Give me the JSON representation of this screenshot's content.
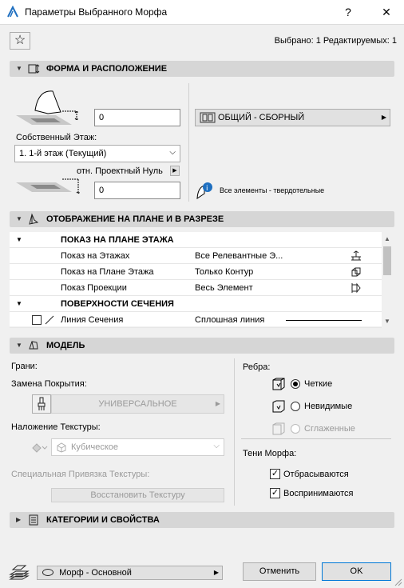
{
  "window": {
    "title": "Параметры Выбранного Морфа",
    "help_label": "?",
    "close_label": "✕"
  },
  "selection_info": "Выбрано: 1 Редактируемых: 1",
  "sections": {
    "shape": "ФОРМА И РАСПОЛОЖЕНИЕ",
    "plan": "ОТОБРАЖЕНИЕ НА ПЛАНЕ И В РАЗРЕЗЕ",
    "model": "МОДЕЛЬ",
    "categories": "КАТЕГОРИИ И СВОЙСТВА"
  },
  "shape": {
    "top_offset_value": "0",
    "home_story_label": "Собственный Этаж:",
    "home_story_value": "1. 1-й этаж (Текущий)",
    "relative_to_label": "отн. Проектный Нуль",
    "bottom_offset_value": "0",
    "layer_value": "ОБЩИЙ - СБОРНЫЙ",
    "solid_label": "Все элементы - твердотельные"
  },
  "plan_tree": {
    "group1": "ПОКАЗ НА ПЛАНЕ ЭТАЖА",
    "rows1": [
      {
        "name": "Показ на Этажах",
        "value": "Все Релевантные Э..."
      },
      {
        "name": "Показ на Плане Этажа",
        "value": "Только Контур"
      },
      {
        "name": "Показ Проекции",
        "value": "Весь Элемент"
      }
    ],
    "group2": "ПОВЕРХНОСТИ СЕЧЕНИЯ",
    "rows2": [
      {
        "name": "Линия Сечения",
        "value": "Сплошная линия"
      }
    ]
  },
  "model": {
    "faces_label": "Грани:",
    "override_label": "Замена Покрытия:",
    "override_value": "УНИВЕРСАЛЬНОЕ",
    "texture_label": "Наложение Текстуры:",
    "texture_value": "Кубическое",
    "special_texture_label": "Специальная Привязка Текстуры:",
    "restore_texture_label": "Восстановить Текстуру",
    "edges_label": "Ребра:",
    "edge_options": [
      "Четкие",
      "Невидимые",
      "Сглаженные"
    ],
    "shadows_label": "Тени Морфа:",
    "shadow_options": [
      "Отбрасываются",
      "Воспринимаются"
    ]
  },
  "footer": {
    "view_value": "Морф - Основной",
    "cancel_label": "Отменить",
    "ok_label": "OK"
  }
}
